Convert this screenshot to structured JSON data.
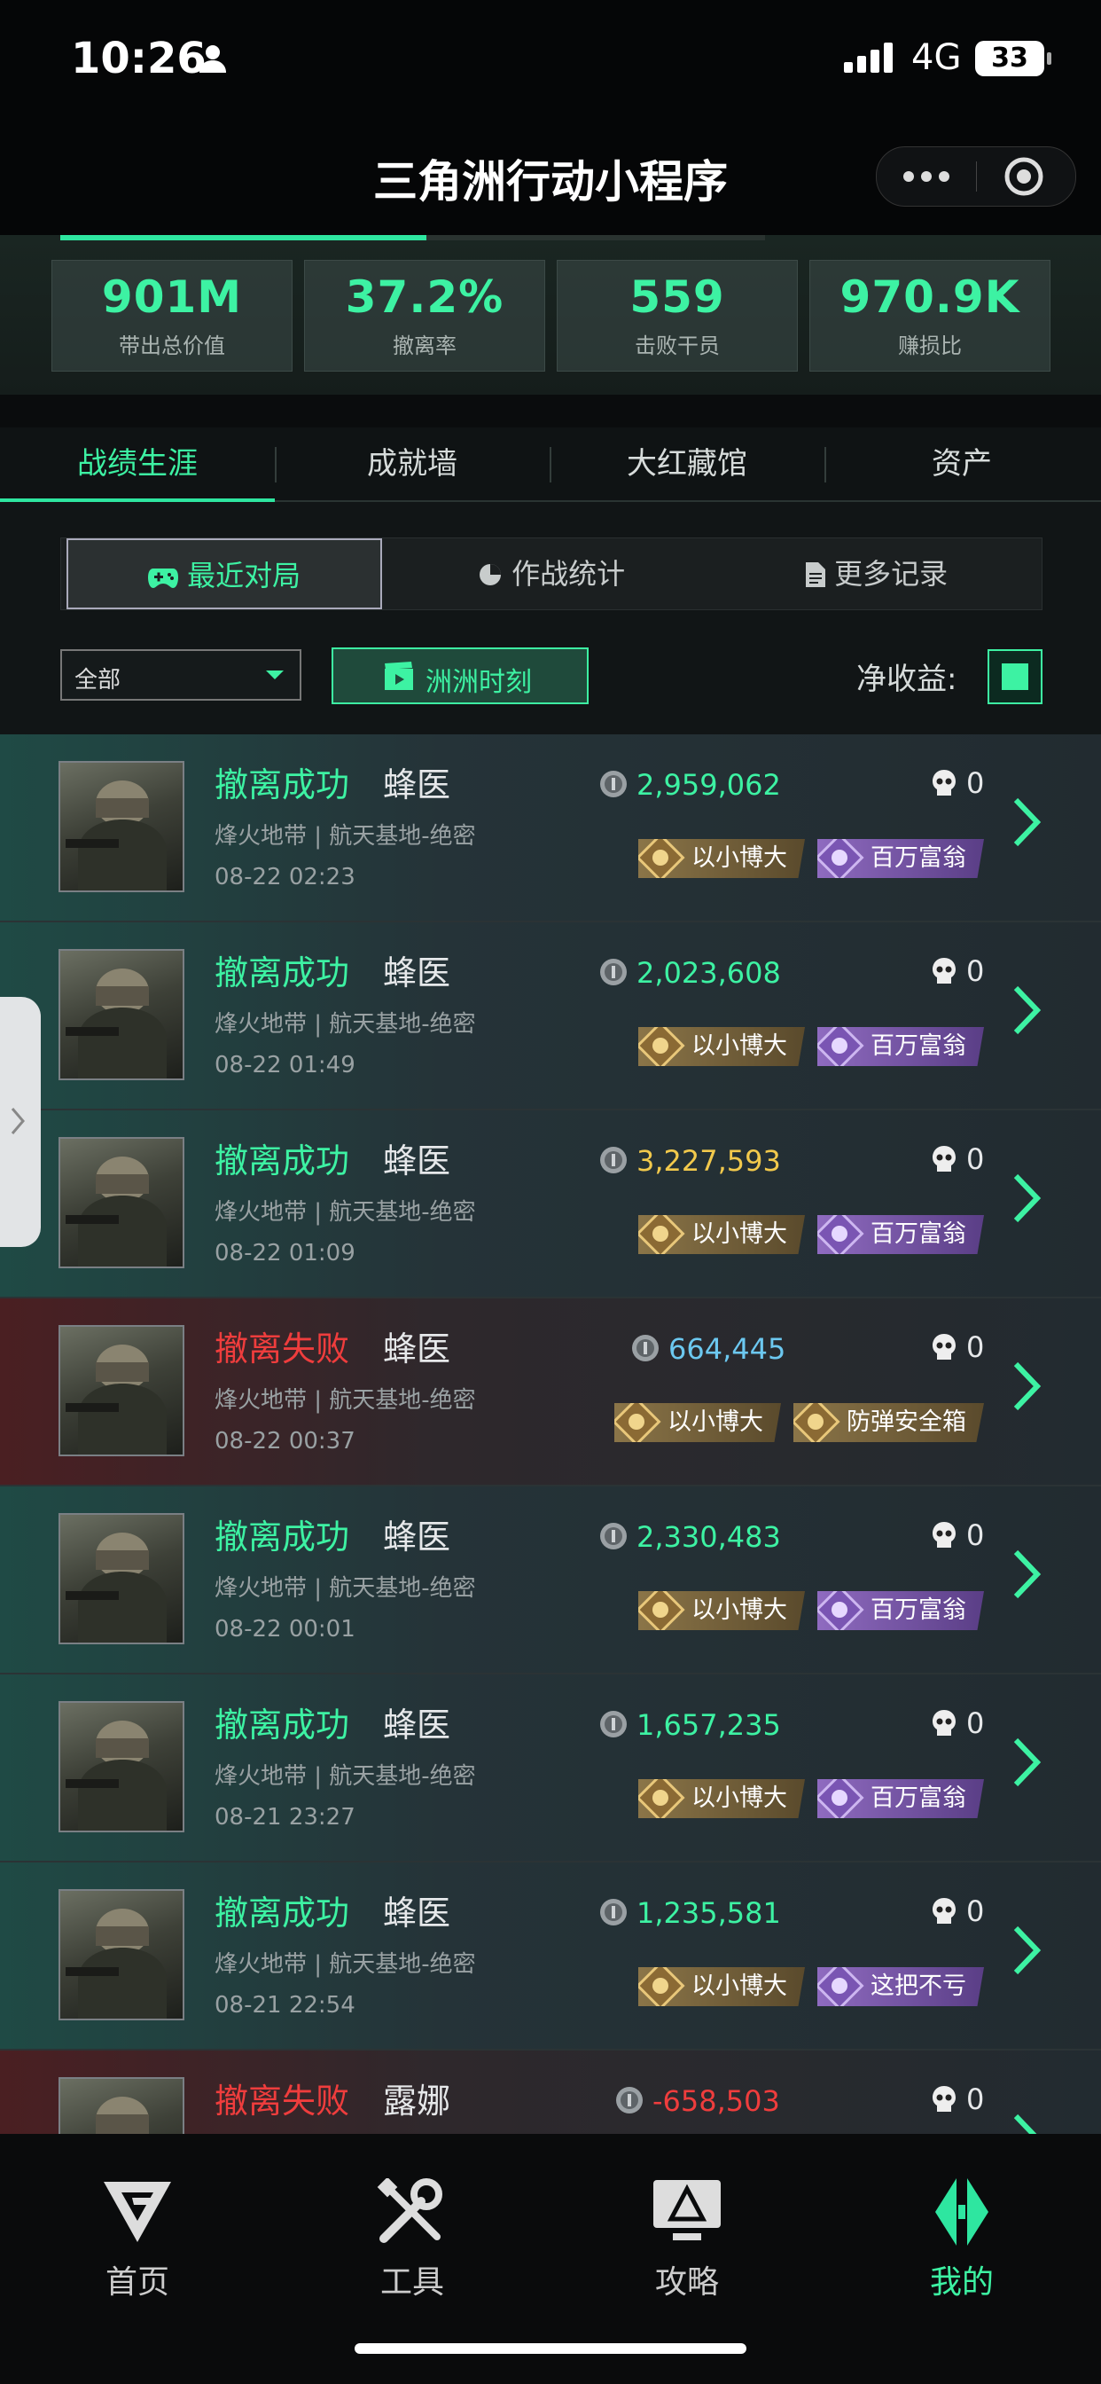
{
  "status_bar": {
    "time": "10:26",
    "network": "4G",
    "battery": "33"
  },
  "nav": {
    "title": "三角洲行动小程序"
  },
  "stats": [
    {
      "value": "901M",
      "label": "带出总价值"
    },
    {
      "value": "37.2%",
      "label": "撤离率"
    },
    {
      "value": "559",
      "label": "击败干员"
    },
    {
      "value": "970.9K",
      "label": "赚损比"
    }
  ],
  "tabs": [
    "战绩生涯",
    "成就墙",
    "大红藏馆",
    "资产"
  ],
  "subtabs": [
    "最近对局",
    "作战统计",
    "更多记录"
  ],
  "filter": {
    "selected": "全部",
    "moment_button": "洲洲时刻",
    "net_label": "净收益:"
  },
  "colors": {
    "accent": "#3df2a3",
    "success": "#3df2a3",
    "fail": "#ef3d3d",
    "gold": "#f2c94c",
    "blue": "#6cc8f0"
  },
  "matches": [
    {
      "result": "撤离成功",
      "status": "ok",
      "operator": "蜂医",
      "map": "烽火地带 | 航天基地-绝密",
      "datetime": "08-22 02:23",
      "value": "2,959,062",
      "value_color": "#3df2a3",
      "kills": "0",
      "badges": [
        {
          "label": "以小博大",
          "style": "gold"
        },
        {
          "label": "百万富翁",
          "style": "purple"
        }
      ]
    },
    {
      "result": "撤离成功",
      "status": "ok",
      "operator": "蜂医",
      "map": "烽火地带 | 航天基地-绝密",
      "datetime": "08-22 01:49",
      "value": "2,023,608",
      "value_color": "#3df2a3",
      "kills": "0",
      "badges": [
        {
          "label": "以小博大",
          "style": "gold"
        },
        {
          "label": "百万富翁",
          "style": "purple"
        }
      ]
    },
    {
      "result": "撤离成功",
      "status": "ok",
      "operator": "蜂医",
      "map": "烽火地带 | 航天基地-绝密",
      "datetime": "08-22 01:09",
      "value": "3,227,593",
      "value_color": "#f2c94c",
      "kills": "0",
      "badges": [
        {
          "label": "以小博大",
          "style": "gold"
        },
        {
          "label": "百万富翁",
          "style": "purple"
        }
      ]
    },
    {
      "result": "撤离失败",
      "status": "fail",
      "operator": "蜂医",
      "map": "烽火地带 | 航天基地-绝密",
      "datetime": "08-22 00:37",
      "value": "664,445",
      "value_color": "#6cc8f0",
      "kills": "0",
      "badges": [
        {
          "label": "以小博大",
          "style": "gold"
        },
        {
          "label": "防弹安全箱",
          "style": "gold"
        }
      ]
    },
    {
      "result": "撤离成功",
      "status": "ok",
      "operator": "蜂医",
      "map": "烽火地带 | 航天基地-绝密",
      "datetime": "08-22 00:01",
      "value": "2,330,483",
      "value_color": "#3df2a3",
      "kills": "0",
      "badges": [
        {
          "label": "以小博大",
          "style": "gold"
        },
        {
          "label": "百万富翁",
          "style": "purple"
        }
      ]
    },
    {
      "result": "撤离成功",
      "status": "ok",
      "operator": "蜂医",
      "map": "烽火地带 | 航天基地-绝密",
      "datetime": "08-21 23:27",
      "value": "1,657,235",
      "value_color": "#3df2a3",
      "kills": "0",
      "badges": [
        {
          "label": "以小博大",
          "style": "gold"
        },
        {
          "label": "百万富翁",
          "style": "purple"
        }
      ]
    },
    {
      "result": "撤离成功",
      "status": "ok",
      "operator": "蜂医",
      "map": "烽火地带 | 航天基地-绝密",
      "datetime": "08-21 22:54",
      "value": "1,235,581",
      "value_color": "#3df2a3",
      "kills": "0",
      "badges": [
        {
          "label": "以小博大",
          "style": "gold"
        },
        {
          "label": "这把不亏",
          "style": "purple"
        }
      ]
    },
    {
      "result": "撤离失败",
      "status": "fail",
      "operator": "露娜",
      "map": "",
      "datetime": "",
      "value": "-658,503",
      "value_color": "#ef3d3d",
      "kills": "0",
      "badges": []
    }
  ],
  "bottom_nav": [
    {
      "label": "首页",
      "icon": "home-logo-icon"
    },
    {
      "label": "工具",
      "icon": "tools-icon"
    },
    {
      "label": "攻略",
      "icon": "guide-monitor-icon"
    },
    {
      "label": "我的",
      "icon": "profile-logo-icon",
      "active": true
    }
  ]
}
